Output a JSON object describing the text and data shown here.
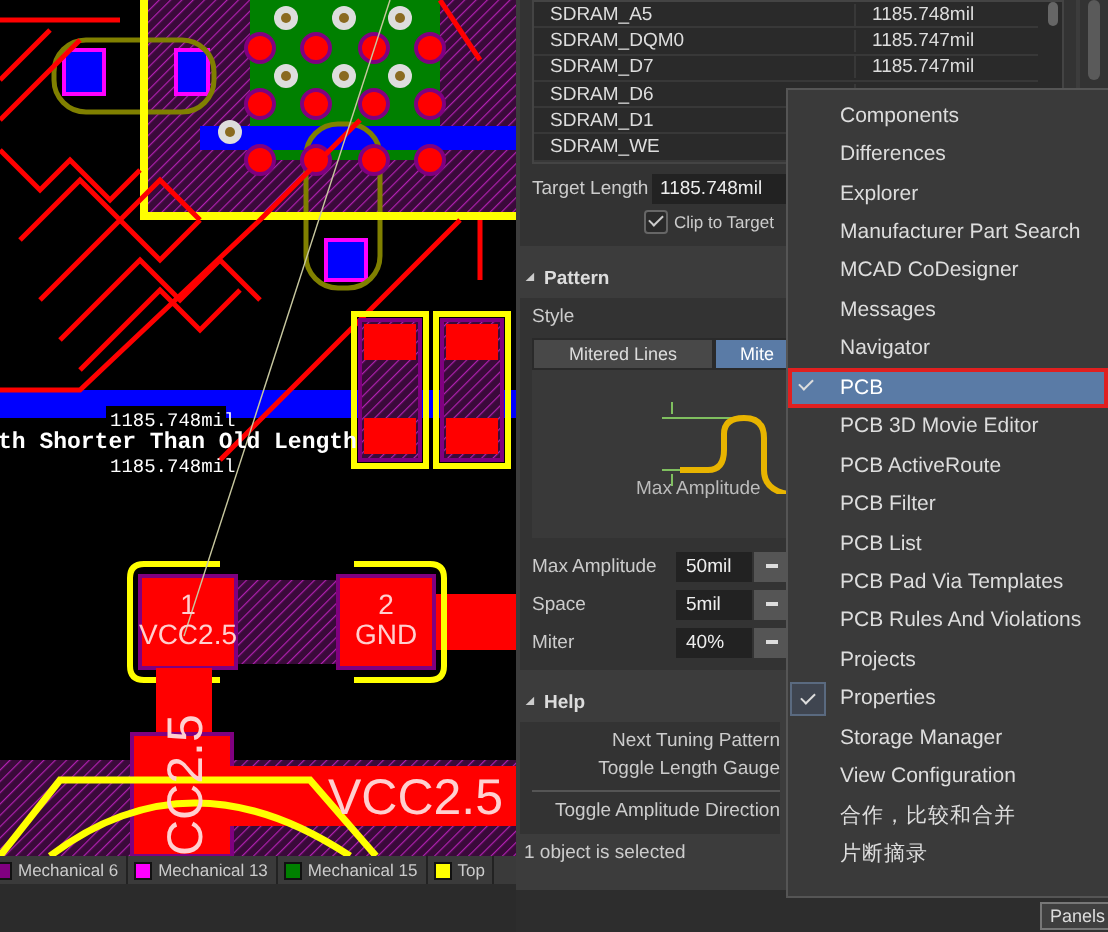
{
  "pcb": {
    "length_labels": [
      "1185.748mil",
      "1185.748mil"
    ],
    "message": "th Shorter Than Old Length",
    "components": [
      {
        "pin": "1",
        "net": "VCC2.5"
      },
      {
        "pin": "2",
        "net": "GND"
      }
    ],
    "net_labels": [
      {
        "kind": "vertical",
        "text": "CC2.5"
      },
      {
        "kind": "horizontal",
        "text": "VCC2.5"
      }
    ]
  },
  "layer_tabs": [
    {
      "label": "Mechanical 6",
      "color": "#800080"
    },
    {
      "label": "Mechanical 13",
      "color": "#ff00ff"
    },
    {
      "label": "Mechanical 15",
      "color": "#008000"
    },
    {
      "label": "Top",
      "color": "#ffff00"
    }
  ],
  "net_table": {
    "rows": [
      {
        "net": "SDRAM_A5",
        "length": "1185.748mil"
      },
      {
        "net": "SDRAM_DQM0",
        "length": "1185.747mil"
      },
      {
        "net": "SDRAM_D7",
        "length": "1185.747mil"
      },
      {
        "net": "SDRAM_D6"
      },
      {
        "net": "SDRAM_D1"
      },
      {
        "net": "SDRAM_WE"
      }
    ]
  },
  "target_length": {
    "label": "Target Length",
    "value": "1185.748mil"
  },
  "clip_to_target": {
    "label": "Clip to Target",
    "checked": true
  },
  "pattern": {
    "title": "Pattern",
    "expanded": true,
    "style_label": "Style",
    "styles": [
      {
        "label": "Mitered Lines",
        "selected": false
      },
      {
        "label": "Mite",
        "selected": true
      }
    ],
    "preview_label": "Max Amplitude",
    "fields": [
      {
        "label": "Max Amplitude",
        "value": "50mil"
      },
      {
        "label": "Space",
        "value": "5mil"
      },
      {
        "label": "Miter",
        "value": "40%"
      }
    ]
  },
  "help": {
    "title": "Help",
    "expanded": true,
    "commands": [
      "Next Tuning Pattern",
      "Toggle Length Gauge",
      "Toggle Amplitude Direction"
    ]
  },
  "status_bar": "1 object is selected",
  "panels_button": "Panels",
  "panels_menu": [
    {
      "label": "Components",
      "checked": false,
      "selected": false
    },
    {
      "label": "Differences",
      "checked": false,
      "selected": false
    },
    {
      "label": "Explorer",
      "checked": false,
      "selected": false
    },
    {
      "label": "Manufacturer Part Search",
      "checked": false,
      "selected": false
    },
    {
      "label": "MCAD CoDesigner",
      "checked": false,
      "selected": false
    },
    {
      "label": "Messages",
      "checked": false,
      "selected": false
    },
    {
      "label": "Navigator",
      "checked": false,
      "selected": false
    },
    {
      "label": "PCB",
      "checked": true,
      "selected": true
    },
    {
      "label": "PCB 3D Movie Editor",
      "checked": false,
      "selected": false
    },
    {
      "label": "PCB ActiveRoute",
      "checked": false,
      "selected": false
    },
    {
      "label": "PCB Filter",
      "checked": false,
      "selected": false
    },
    {
      "label": "PCB List",
      "checked": false,
      "selected": false
    },
    {
      "label": "PCB Pad Via Templates",
      "checked": false,
      "selected": false
    },
    {
      "label": "PCB Rules And Violations",
      "checked": false,
      "selected": false
    },
    {
      "label": "Projects",
      "checked": false,
      "selected": false
    },
    {
      "label": "Properties",
      "checked": true,
      "selected": false
    },
    {
      "label": "Storage Manager",
      "checked": false,
      "selected": false
    },
    {
      "label": "View Configuration",
      "checked": false,
      "selected": false
    },
    {
      "label": "合作，比较和合并",
      "checked": false,
      "selected": false
    },
    {
      "label": "片断摘录",
      "checked": false,
      "selected": false
    }
  ]
}
